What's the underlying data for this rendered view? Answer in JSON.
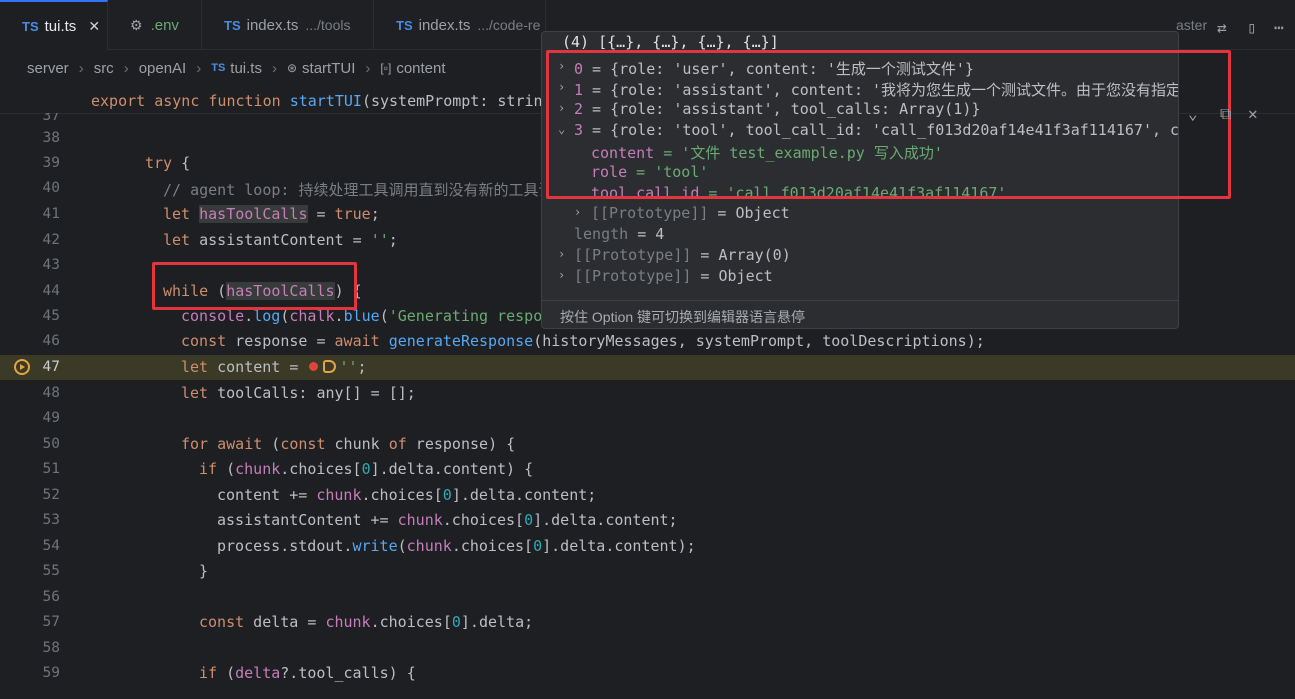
{
  "tabs": [
    {
      "label": "tui.ts",
      "desc": "",
      "close": "✕"
    },
    {
      "label": ".env",
      "desc": ""
    },
    {
      "label": "index.ts",
      "desc": ".../tools"
    },
    {
      "label": "index.ts",
      "desc": ".../code-re"
    }
  ],
  "tab_overflow": "aster",
  "breadcrumb": [
    "server",
    "src",
    "openAI",
    "tui.ts",
    "startTUI",
    "content"
  ],
  "sticky_line": {
    "kw": "export async function",
    "name": "startTUI",
    "rest": "(systemPrompt: strin"
  },
  "code": {
    "l38": "}",
    "l39_kw": "try",
    "l39_rest": " {",
    "l40": "// agent loop: 持续处理工具调用直到没有新的工具调",
    "l41_kw": "let",
    "l41_var": "hasToolCalls",
    "l41_eq": " = ",
    "l41_val": "true",
    "l41_end": ";",
    "l42_kw": "let",
    "l42_var": "assistantContent",
    "l42_eq": " = ",
    "l42_val": "''",
    "l42_end": ";",
    "l44_kw": "while",
    "l44_p1": " (",
    "l44_var": "hasToolCalls",
    "l44_p2": ") {",
    "l45_obj": "console",
    "l45_dot": ".",
    "l45_fn": "log",
    "l45_p": "(",
    "l45_obj2": "chalk",
    "l45_fn2": "blue",
    "l45_str": "'Generating respo",
    "l46_kw": "const",
    "l46_var": " response",
    "l46_eq": " = ",
    "l46_aw": "await",
    "l46_fn": " generateResponse",
    "l46_args": "(historyMessages, systemPrompt, toolDescriptions);",
    "l47_kw": "let",
    "l47_var": " content",
    "l47_eq": " = ",
    "l47_str": "''",
    "l47_end": ";",
    "l48_kw": "let",
    "l48_var": " toolCalls",
    "l48_type": ": any[] = [];",
    "l50_kw": "for await",
    "l50_p": " (",
    "l50_c": "const",
    "l50_var": " chunk",
    "l50_of": " of",
    "l50_r": " response",
    "l50_end": ") {",
    "l51_kw": "if",
    "l51_p": " (",
    "l51_var": "chunk",
    "l51_a": ".choices[",
    "l51_n": "0",
    "l51_b": "].delta.content) {",
    "l52_var": "content",
    "l52_op": " += ",
    "l52_v2": "chunk",
    "l52_a": ".choices[",
    "l52_n": "0",
    "l52_b": "].delta.content;",
    "l53_var": "assistantContent",
    "l53_op": " += ",
    "l53_v2": "chunk",
    "l53_a": ".choices[",
    "l53_n": "0",
    "l53_b": "].delta.content;",
    "l54_a": "process.stdout.",
    "l54_fn": "write",
    "l54_p": "(",
    "l54_v": "chunk",
    "l54_b": ".choices[",
    "l54_n": "0",
    "l54_c": "].delta.content);",
    "l55": "}",
    "l57_kw": "const",
    "l57_var": " delta",
    "l57_eq": " = ",
    "l57_v": "chunk",
    "l57_a": ".choices[",
    "l57_n": "0",
    "l57_b": "].delta;",
    "l59_kw": "if",
    "l59_p": " (",
    "l59_v": "delta",
    "l59_b": "?.tool_calls) {"
  },
  "line_numbers": [
    "37",
    "38",
    "39",
    "40",
    "41",
    "42",
    "43",
    "44",
    "45",
    "46",
    "47",
    "48",
    "49",
    "50",
    "51",
    "52",
    "53",
    "54",
    "55",
    "56",
    "57",
    "58",
    "59"
  ],
  "popup": {
    "header": "(4) [{…}, {…}, {…}, {…}]",
    "rows": [
      {
        "k": "0",
        "v": " = {role: 'user', content: '生成一个测试文件'}"
      },
      {
        "k": "1",
        "v": " = {role: 'assistant', content: '我将为您生成一个测试文件。由于您没有指定"
      },
      {
        "k": "2",
        "v": " = {role: 'assistant', tool_calls: Array(1)}"
      },
      {
        "k": "3",
        "v": " = {role: 'tool', tool_call_id: 'call_f013d20af14e41f3af114167', co"
      },
      {
        "k": "content",
        "v": " = '文件 test_example.py 写入成功'"
      },
      {
        "k": "role",
        "v": " = 'tool'"
      },
      {
        "k": "tool_call_id",
        "v": " = 'call_f013d20af14e41f3af114167'"
      },
      {
        "k": "[[Prototype]]",
        "v": " = Object"
      },
      {
        "k": "length",
        "v": " = 4"
      },
      {
        "k": "[[Prototype]]",
        "v": " = Array(0)"
      },
      {
        "k": "[[Prototype]]",
        "v": " = Object"
      }
    ],
    "footer": "按住 Option 键可切换到编辑器语言悬停"
  }
}
